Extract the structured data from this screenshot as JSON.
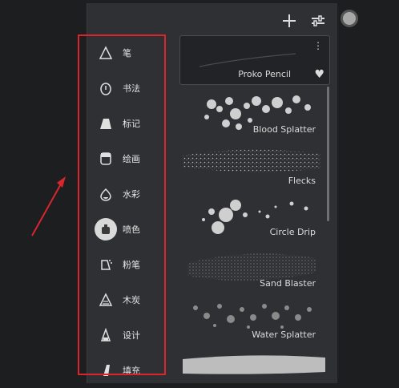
{
  "toolbar": {
    "add_icon": "plus-icon",
    "adjust_icon": "sliders-icon"
  },
  "color": {
    "current": "#a8a8a8"
  },
  "categories": [
    {
      "label": "笔",
      "icon": "pen-icon"
    },
    {
      "label": "书法",
      "icon": "calligraphy-icon"
    },
    {
      "label": "标记",
      "icon": "marker-icon"
    },
    {
      "label": "绘画",
      "icon": "paint-icon"
    },
    {
      "label": "水彩",
      "icon": "watercolor-icon"
    },
    {
      "label": "喷色",
      "icon": "airbrush-icon",
      "selected": true
    },
    {
      "label": "粉笔",
      "icon": "chalk-icon"
    },
    {
      "label": "木炭",
      "icon": "charcoal-icon"
    },
    {
      "label": "设计",
      "icon": "design-icon"
    },
    {
      "label": "填充",
      "icon": "fill-icon"
    }
  ],
  "brushes": [
    {
      "name": "Proko Pencil",
      "selected": true
    },
    {
      "name": "Blood Splatter"
    },
    {
      "name": "Flecks"
    },
    {
      "name": "Circle Drip"
    },
    {
      "name": "Sand Blaster"
    },
    {
      "name": "Water Splatter"
    }
  ]
}
